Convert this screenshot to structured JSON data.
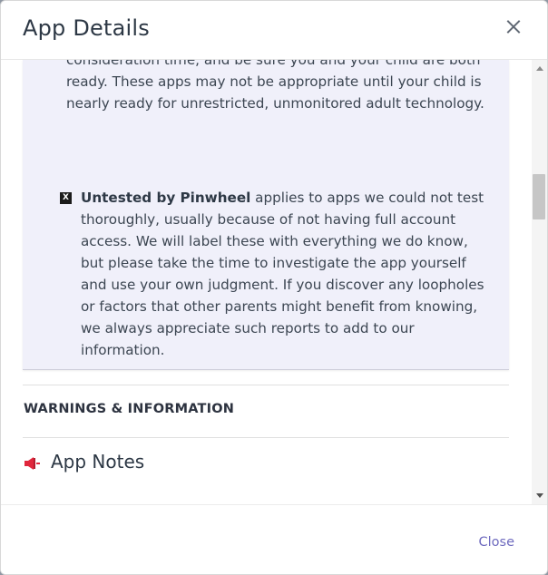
{
  "modal": {
    "title": "App Details",
    "close_icon": "close-x-icon"
  },
  "content": {
    "para_top": "alternatives with them.) Please give these apps serious consideration time, and be sure you and your child are both ready. These apps may not be appropriate until your child is nearly ready for unrestricted, unmonitored adult technology.",
    "untested": {
      "badge": "X",
      "bold": "Untested by Pinwheel",
      "text": " applies to apps we could not test thoroughly, usually because of not having full account access. We will label these with everything we do know, but please take the time to investigate the app yourself and use your own judgment. If you discover any loopholes or factors that other parents might benefit from knowing, we always appreciate such reports to add to our information."
    },
    "section_heading": "WARNINGS & INFORMATION",
    "app_notes": {
      "label": "App Notes",
      "icon": "megaphone-icon",
      "icon_color": "#e0263c"
    }
  },
  "footer": {
    "close_label": "Close",
    "accent": "#6f6bbf"
  }
}
